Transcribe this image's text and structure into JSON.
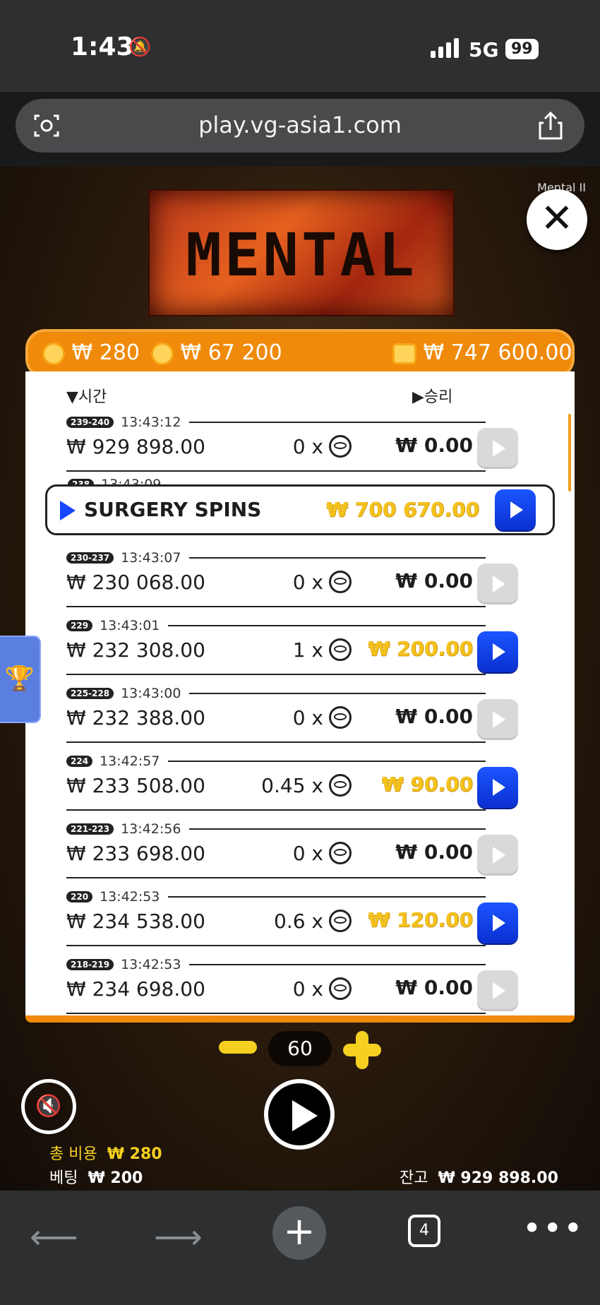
{
  "status_bar": {
    "time": "1:43",
    "network": "5G",
    "battery": "99"
  },
  "browser": {
    "url": "play.vg-asia1.com",
    "tab_count": "4"
  },
  "game": {
    "title": "MENTAL",
    "label": "Mental II"
  },
  "header": {
    "bet_coin": "₩ 280",
    "total_coin": "₩ 67 200",
    "balance": "₩ 747 600.00"
  },
  "history": {
    "col_time": "▼시간",
    "col_win": "▶승리",
    "rows": [
      {
        "round": "239-240",
        "time": "13:43:12",
        "bet": "₩ 929 898.00",
        "mult": "0 x",
        "win": "₩ 0.00",
        "gold": false
      },
      {
        "round": "238",
        "time": "13:43:09",
        "label": "SURGERY SPINS",
        "win": "₩ 700 670.00",
        "gold": true
      },
      {
        "round": "230-237",
        "time": "13:43:07",
        "bet": "₩ 230 068.00",
        "mult": "0 x",
        "win": "₩ 0.00",
        "gold": false
      },
      {
        "round": "229",
        "time": "13:43:01",
        "bet": "₩ 232 308.00",
        "mult": "1 x",
        "win": "₩ 200.00",
        "gold": true
      },
      {
        "round": "225-228",
        "time": "13:43:00",
        "bet": "₩ 232 388.00",
        "mult": "0 x",
        "win": "₩ 0.00",
        "gold": false
      },
      {
        "round": "224",
        "time": "13:42:57",
        "bet": "₩ 233 508.00",
        "mult": "0.45 x",
        "win": "₩ 90.00",
        "gold": true
      },
      {
        "round": "221-223",
        "time": "13:42:56",
        "bet": "₩ 233 698.00",
        "mult": "0 x",
        "win": "₩ 0.00",
        "gold": false
      },
      {
        "round": "220",
        "time": "13:42:53",
        "bet": "₩ 234 538.00",
        "mult": "0.6 x",
        "win": "₩ 120.00",
        "gold": true
      },
      {
        "round": "218-219",
        "time": "13:42:53",
        "bet": "₩ 234 698.00",
        "mult": "0 x",
        "win": "₩ 0.00",
        "gold": false
      }
    ]
  },
  "controls": {
    "step_value": "60",
    "total_cost_label": "총 비용",
    "total_cost_value": "₩ 280",
    "bet_label": "베팅",
    "bet_value": "₩ 200",
    "balance_label": "잔고",
    "balance_value": "₩ 929 898.00"
  },
  "icons": {
    "camera": "camera-scan-icon",
    "share": "share-icon",
    "close": "close-icon",
    "trophy": "trophy-icon",
    "mute": "mute-icon",
    "spin": "play-icon",
    "back": "back-arrow-icon",
    "forward": "forward-arrow-icon",
    "new_tab": "plus-icon",
    "tabs": "tabs-icon",
    "more": "more-icon"
  },
  "colors": {
    "accent_orange": "#f08a0a",
    "gold": "#f5c21b",
    "replay_blue": "#1b55ff",
    "yellow": "#f5d020"
  }
}
